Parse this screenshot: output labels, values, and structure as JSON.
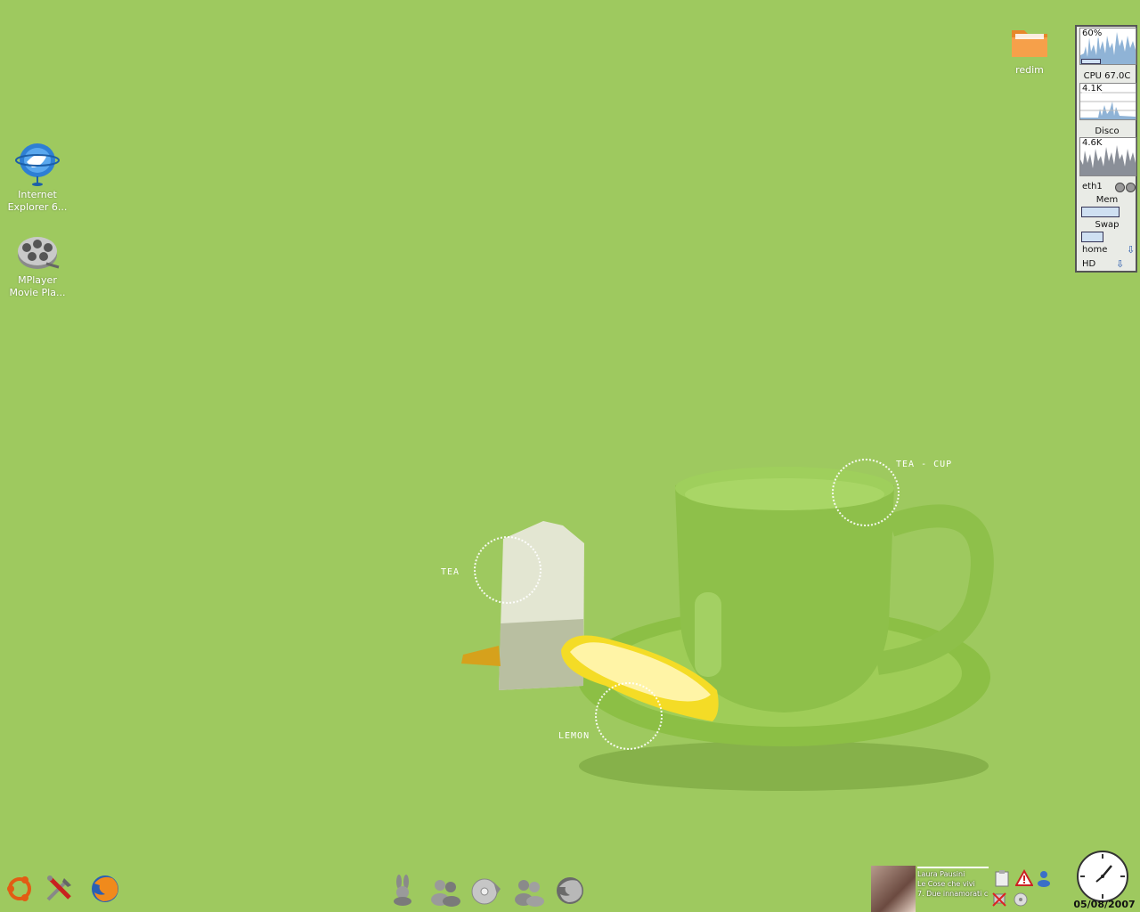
{
  "desktop": {
    "icons": [
      {
        "label_line1": "Internet",
        "label_line2": "Explorer 6...",
        "icon": "internet-explorer-icon"
      },
      {
        "label_line1": "MPlayer",
        "label_line2": "Movie Pla...",
        "icon": "mplayer-icon"
      },
      {
        "label": "redim",
        "icon": "folder-icon"
      }
    ]
  },
  "wallpaper": {
    "labels": {
      "tea": "TEA",
      "tea_cup": "TEA - CUP",
      "lemon": "LEMON"
    }
  },
  "gkrellm": {
    "cpu_percent": "60%",
    "cpu_temp": "CPU 67.0C",
    "disk_rate": "4.1K",
    "disk_label": "Disco",
    "net_rate": "4.6K",
    "net_label": "eth1",
    "mem_label": "Mem",
    "mem_fill": 0.7,
    "swap_label": "Swap",
    "swap_fill": 0.4,
    "fs": [
      {
        "label": "home"
      },
      {
        "label": "HD"
      }
    ]
  },
  "taskbar": {
    "left_icons": [
      "ubuntu-menu-icon",
      "tools-icon",
      "firefox-icon"
    ],
    "center_icons": [
      "bunny-icon",
      "messenger-icon",
      "cd-player-icon",
      "contacts-icon",
      "web-browser-icon"
    ],
    "now_playing": {
      "artist": "Laura Pausini",
      "album": "Le Cose che vivi",
      "track": "7. Due innamorati c"
    },
    "date": "05/08/2007"
  },
  "colors": {
    "background": "#9ec95f",
    "cup": "#8ec04a",
    "lemon": "#f4dc26"
  }
}
